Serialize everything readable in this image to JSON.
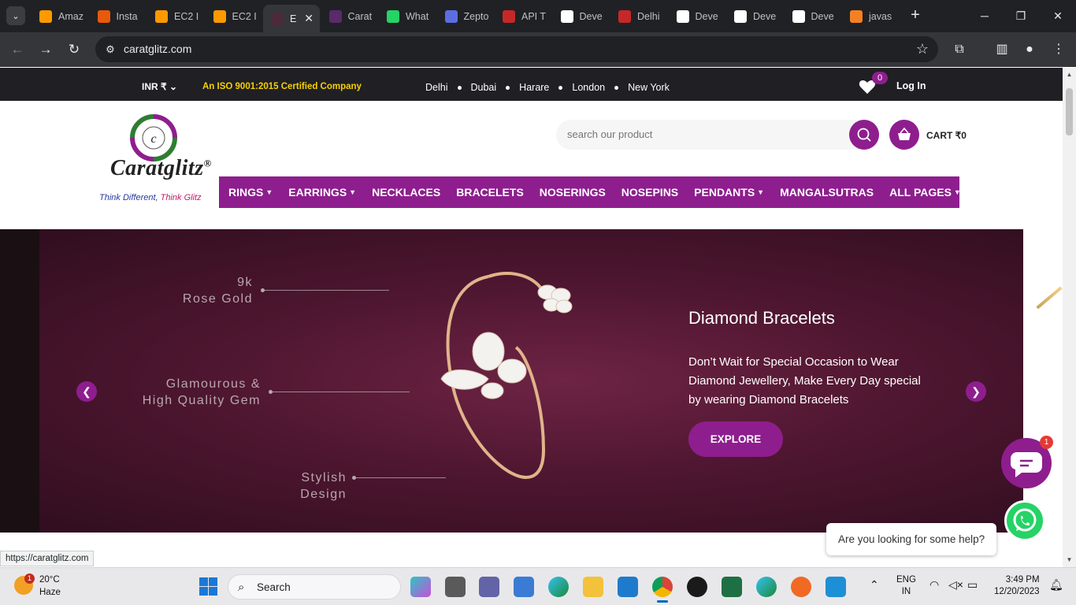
{
  "browser": {
    "tabs": [
      {
        "label": "Amaz",
        "color": "#ff9900"
      },
      {
        "label": "Insta",
        "color": "#e8590c"
      },
      {
        "label": "EC2 I",
        "color": "#ff9900"
      },
      {
        "label": "EC2 I",
        "color": "#ff9900"
      },
      {
        "label": "E",
        "color": "#4b2a3c",
        "active": true
      },
      {
        "label": "Carat",
        "color": "#5a2a6a"
      },
      {
        "label": "What",
        "color": "#25d366"
      },
      {
        "label": "Zepto",
        "color": "#5b6ee1"
      },
      {
        "label": "API T",
        "color": "#c62828"
      },
      {
        "label": "Deve",
        "color": "#ffffff"
      },
      {
        "label": "Delhi",
        "color": "#c62828"
      },
      {
        "label": "Deve",
        "color": "#ffffff"
      },
      {
        "label": "Deve",
        "color": "#ffffff"
      },
      {
        "label": "Deve",
        "color": "#ffffff"
      },
      {
        "label": "javas",
        "color": "#f48024"
      }
    ],
    "url": "caratglitz.com",
    "status_url": "https://caratglitz.com"
  },
  "topbar": {
    "currency": "INR ₹",
    "iso": "An ISO 9001:2015 Certified Company",
    "cities": [
      "Delhi",
      "Dubai",
      "Harare",
      "London",
      "New York"
    ],
    "wishlist_count": "0",
    "login": "Log In"
  },
  "header": {
    "logo_text": "Caratglitz",
    "logo_reg": "®",
    "tag_a": "Think Different,",
    "tag_b": "Think Glitz",
    "search_placeholder": "search our product",
    "cart_label": "CART ₹0"
  },
  "nav": [
    {
      "label": "RINGS",
      "dropdown": true
    },
    {
      "label": "EARRINGS",
      "dropdown": true
    },
    {
      "label": "NECKLACES",
      "dropdown": false
    },
    {
      "label": "BRACELETS",
      "dropdown": false
    },
    {
      "label": "NOSERINGS",
      "dropdown": false
    },
    {
      "label": "NOSEPINS",
      "dropdown": false
    },
    {
      "label": "PENDANTS",
      "dropdown": true
    },
    {
      "label": "MANGALSUTRAS",
      "dropdown": false
    },
    {
      "label": "ALL PAGES",
      "dropdown": true
    }
  ],
  "hero": {
    "feature_1": [
      "9k",
      "Rose Gold"
    ],
    "feature_2": [
      "Glamourous &",
      "High Quality Gem"
    ],
    "feature_3": [
      "Stylish Design"
    ],
    "title": "Diamond Bracelets",
    "description": "Don’t Wait for Special Occasion to Wear Diamond Jewellery, Make Every Day special by wearing Diamond Bracelets",
    "button": "EXPLORE"
  },
  "widgets": {
    "chat_badge": "1",
    "help_text": "Are you looking for some help?"
  },
  "taskbar": {
    "weather_temp": "20°C",
    "weather_desc": "Haze",
    "weather_badge": "1",
    "search_label": "Search",
    "lang_1": "ENG",
    "lang_2": "IN",
    "time": "3:49 PM",
    "date": "12/20/2023"
  },
  "colors": {
    "brand_purple": "#8e1e8e",
    "topbar_bg": "#1f1f24",
    "iso_yellow": "#f7d000"
  }
}
